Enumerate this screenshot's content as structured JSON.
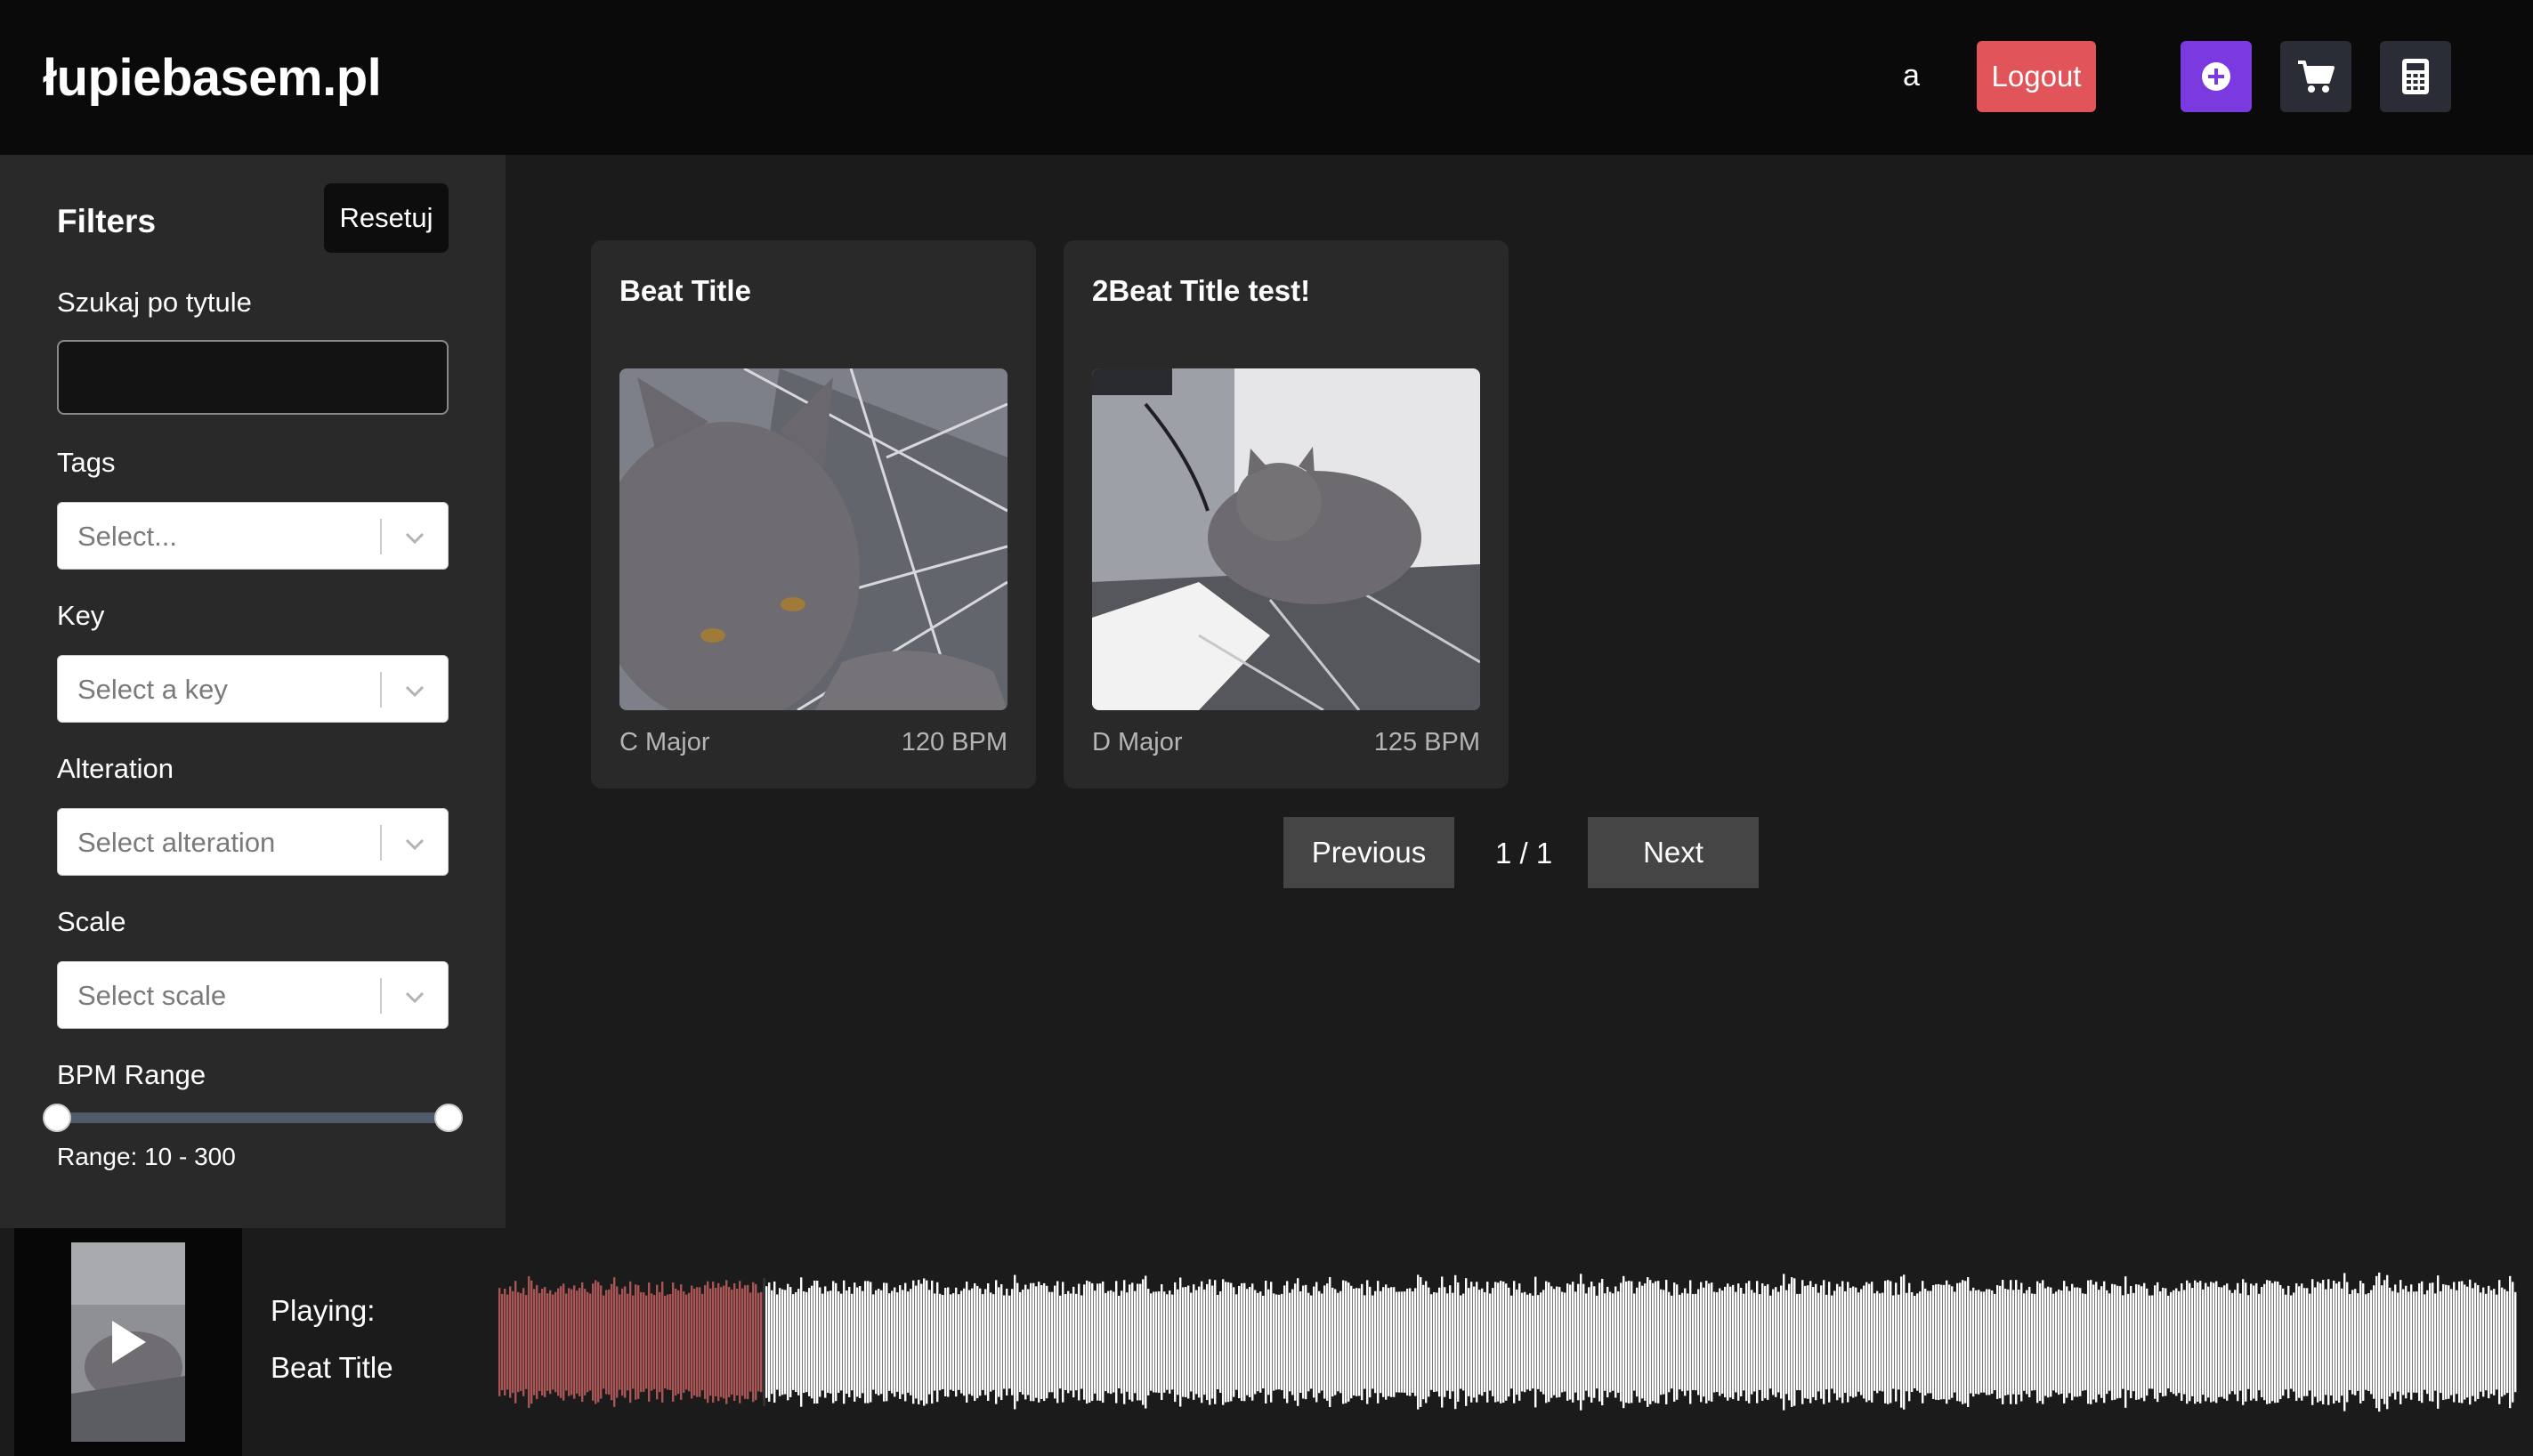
{
  "header": {
    "logo": "łupiebasem.pl",
    "username": "a",
    "logout_label": "Logout",
    "icons": [
      "plus-circle-icon",
      "cart-icon",
      "calculator-icon"
    ],
    "colors": {
      "logout": "#e0545a",
      "add": "#7b3ae0",
      "icon_button": "#2a2d36"
    }
  },
  "sidebar": {
    "title": "Filters",
    "reset_label": "Resetuj",
    "search_label": "Szukaj po tytule",
    "search_value": "",
    "tags": {
      "label": "Tags",
      "placeholder": "Select..."
    },
    "key": {
      "label": "Key",
      "placeholder": "Select a key"
    },
    "alteration": {
      "label": "Alteration",
      "placeholder": "Select alteration"
    },
    "scale": {
      "label": "Scale",
      "placeholder": "Select scale"
    },
    "bpm": {
      "label": "BPM Range",
      "min": 10,
      "max": 300,
      "range_text": "Range: 10 - 300"
    }
  },
  "beats": [
    {
      "title": "Beat Title",
      "key": "C Major",
      "bpm": "120 BPM"
    },
    {
      "title": "2Beat Title test!",
      "key": "D Major",
      "bpm": "125 BPM"
    }
  ],
  "pagination": {
    "previous_label": "Previous",
    "page_info": "1 / 1",
    "next_label": "Next"
  },
  "player": {
    "playing_label": "Playing:",
    "track_title": "Beat Title",
    "progress": 0.13,
    "colors": {
      "played": "#a85555",
      "unplayed": "#ffffff"
    }
  }
}
